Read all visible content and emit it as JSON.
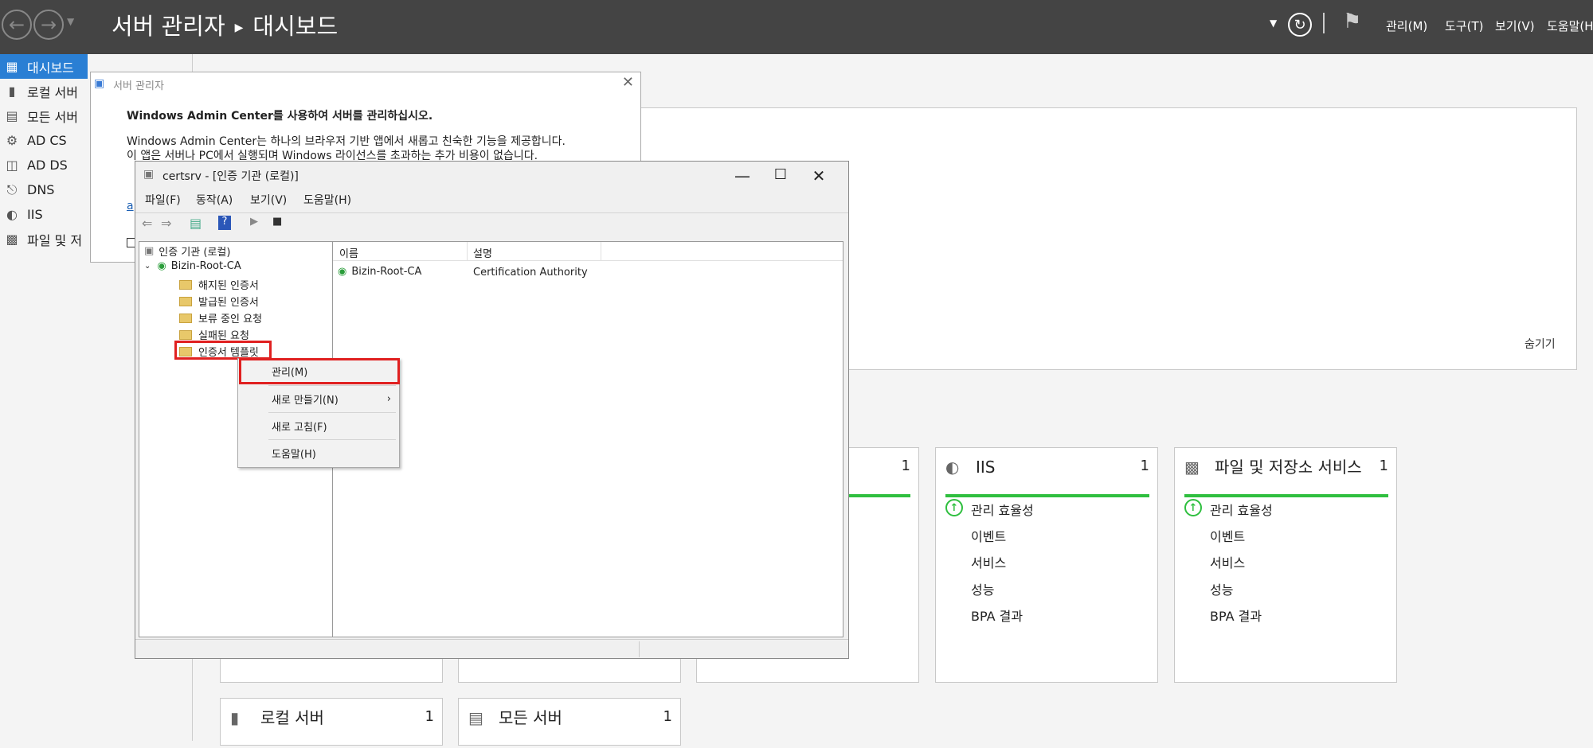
{
  "titlebar": {
    "app": "서버 관리자",
    "page": "대시보드",
    "menu": [
      "관리(M)",
      "도구(T)",
      "보기(V)",
      "도움말(H"
    ]
  },
  "leftnav": {
    "items": [
      {
        "label": "대시보드",
        "icon": "dashboard-icon"
      },
      {
        "label": "로컬 서버",
        "icon": "server-icon"
      },
      {
        "label": "모든 서버",
        "icon": "servers-icon"
      },
      {
        "label": "AD CS",
        "icon": "adcs-icon"
      },
      {
        "label": "AD DS",
        "icon": "adds-icon"
      },
      {
        "label": "DNS",
        "icon": "dns-icon"
      },
      {
        "label": "IIS",
        "icon": "iis-icon"
      },
      {
        "label": "파일 및 저",
        "icon": "file-storage-icon"
      }
    ]
  },
  "welcome": {
    "hide_label": "숨기기"
  },
  "tiles": {
    "partial": {
      "count": "1"
    },
    "iis": {
      "name": "IIS",
      "count": "1",
      "rows": [
        "관리 효율성",
        "이벤트",
        "서비스",
        "성능",
        "BPA 결과"
      ]
    },
    "file": {
      "name": "파일 및 저장소 서비스",
      "count": "1",
      "rows": [
        "관리 효율성",
        "이벤트",
        "서비스",
        "성능",
        "BPA 결과"
      ]
    },
    "local": {
      "name": "로컬 서버",
      "count": "1"
    },
    "all": {
      "name": "모든 서버",
      "count": "1"
    }
  },
  "smpopup": {
    "title": "서버 관리자",
    "heading": "Windows Admin Center를 사용하여 서버를 관리하십시오.",
    "line1": "Windows Admin Center는 하나의 브라우저 기반 앱에서 새롭고 친숙한 기능을 제공합니다.",
    "line2": "이 앱은 서버나 PC에서 실행되며 Windows 라이선스를 초과하는 추가 비용이 없습니다.",
    "link_fragment": "a"
  },
  "certsrv": {
    "title": "certsrv - [인증 기관 (로컬)]",
    "menu": [
      "파일(F)",
      "동작(A)",
      "보기(V)",
      "도움말(H)"
    ],
    "tree": {
      "root": "인증 기관 (로컬)",
      "ca": "Bizin-Root-CA",
      "folders": [
        "해지된 인증서",
        "발급된 인증서",
        "보류 중인 요청",
        "실패된 요청",
        "인증서 템플릿"
      ]
    },
    "list": {
      "columns": [
        "이름",
        "설명"
      ],
      "rows": [
        {
          "name": "Bizin-Root-CA",
          "desc": "Certification Authority"
        }
      ]
    }
  },
  "context_menu": {
    "items": [
      "관리(M)",
      "새로 만들기(N)",
      "새로 고침(F)",
      "도움말(H)"
    ]
  }
}
